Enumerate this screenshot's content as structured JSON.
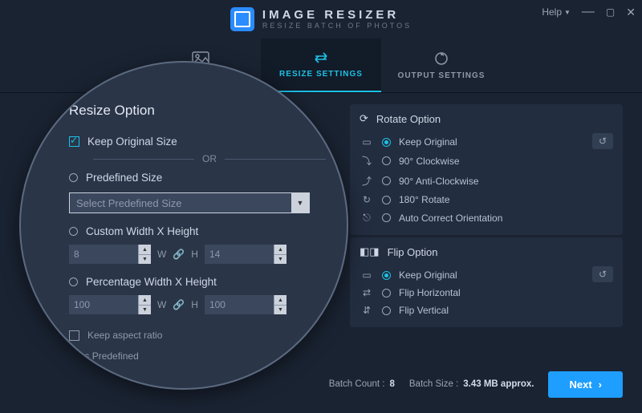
{
  "title": {
    "line1": "IMAGE RESIZER",
    "line2": "RESIZE BATCH OF PHOTOS"
  },
  "window": {
    "help": "Help"
  },
  "tabs": {
    "photos": "PHOTOS",
    "resize": "RESIZE SETTINGS",
    "output": "OUTPUT SETTINGS"
  },
  "resize": {
    "heading": "Resize Option",
    "keep_original": "Keep Original Size",
    "or": "OR",
    "predefined": "Predefined Size",
    "predefined_placeholder": "Select Predefined Size",
    "custom": "Custom Width X Height",
    "custom_w": "8",
    "custom_h": "14",
    "percent": "Percentage Width X Height",
    "percent_w": "100",
    "percent_h": "100",
    "w": "W",
    "h": "H",
    "keep_aspect": "Keep aspect ratio",
    "save_predef": "Save as Predefined"
  },
  "rotate": {
    "heading": "Rotate Option",
    "opts": [
      "Keep Original",
      "90° Clockwise",
      "90° Anti-Clockwise",
      "180° Rotate",
      "Auto Correct Orientation"
    ]
  },
  "flip": {
    "heading": "Flip Option",
    "opts": [
      "Keep Original",
      "Flip Horizontal",
      "Flip Vertical"
    ]
  },
  "footer": {
    "count_label": "Batch Count :",
    "count": "8",
    "size_label": "Batch Size :",
    "size": "3.43 MB approx.",
    "next": "Next"
  }
}
